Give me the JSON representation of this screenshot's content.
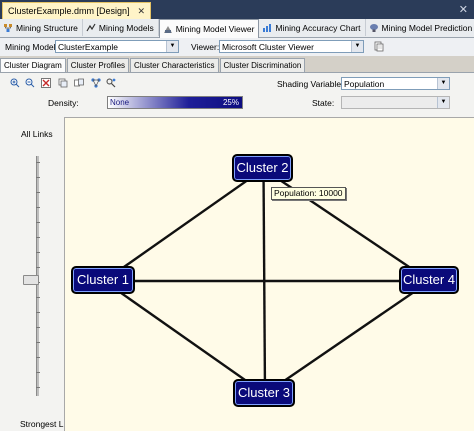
{
  "window": {
    "doc_tab": "ClusterExample.dmm [Design]",
    "doc_close": "✕",
    "close": "✕"
  },
  "designer_tabs": [
    {
      "label": "Mining Structure",
      "icon": "structure-icon"
    },
    {
      "label": "Mining Models",
      "icon": "models-icon"
    },
    {
      "label": "Mining Model Viewer",
      "icon": "viewer-icon",
      "active": true
    },
    {
      "label": "Mining Accuracy Chart",
      "icon": "accuracy-chart-icon"
    },
    {
      "label": "Mining Model Prediction",
      "icon": "prediction-icon"
    }
  ],
  "toolbar": {
    "mining_model_label": "Mining Model:",
    "mining_model_value": "ClusterExample",
    "viewer_label": "Viewer:",
    "viewer_value": "Microsoft Cluster Viewer"
  },
  "view_tabs": [
    {
      "label": "Cluster Diagram",
      "active": true
    },
    {
      "label": "Cluster Profiles"
    },
    {
      "label": "Cluster Characteristics"
    },
    {
      "label": "Cluster Discrimination"
    }
  ],
  "controls": {
    "shading_variable_label": "Shading Variable:",
    "shading_variable_value": "Population",
    "state_label": "State:",
    "state_value": "",
    "density_label": "Density:",
    "density_low": "None",
    "density_high": "25%"
  },
  "slider": {
    "top_label": "All Links",
    "bottom_label": "Strongest Links"
  },
  "diagram": {
    "nodes": [
      {
        "id": "c2",
        "label": "Cluster 2"
      },
      {
        "id": "c1",
        "label": "Cluster 1"
      },
      {
        "id": "c4",
        "label": "Cluster 4"
      },
      {
        "id": "c3",
        "label": "Cluster 3"
      }
    ],
    "tooltip": "Population: 10000"
  },
  "colors": {
    "node_fill": "#0a0a7a",
    "canvas_bg": "#fffbe8",
    "doc_strip": "#2b3c59",
    "active_doc_tab": "#fff4c8"
  }
}
